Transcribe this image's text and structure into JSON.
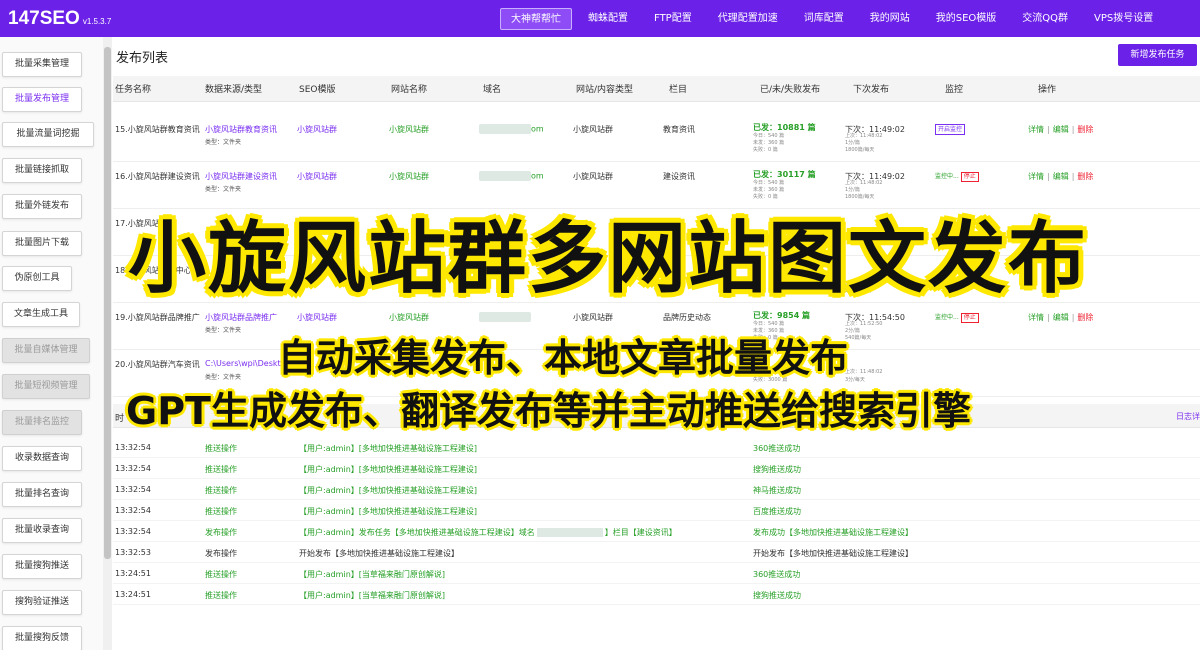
{
  "brand": {
    "name": "147SEO",
    "version": "v1.5.3.7"
  },
  "nav": [
    "大神帮帮忙",
    "蜘蛛配置",
    "FTP配置",
    "代理配置加速",
    "词库配置",
    "我的网站",
    "我的SEO模版",
    "交流QQ群",
    "VPS拨号设置"
  ],
  "sidebar": [
    "批量采集管理",
    "批量发布管理",
    "批量流量词挖掘",
    "批量链接抓取",
    "批量外链发布",
    "批量图片下载",
    "伪原创工具",
    "文章生成工具",
    "批量自媒体管理",
    "批量短视频管理",
    "批量排名监控",
    "收录数据查询",
    "批量排名查询",
    "批量收录查询",
    "批量搜狗推送",
    "搜狗验证推送",
    "批量搜狗反馈"
  ],
  "main": {
    "title": "发布列表",
    "new_task": "新增发布任务",
    "headers": [
      "任务名称",
      "数据来源/类型",
      "SEO模版",
      "网站名称",
      "域名",
      "网站/内容类型",
      "栏目",
      "已/未/失败发布",
      "下次发布",
      "监控",
      "操作"
    ]
  },
  "rows": [
    {
      "name": "15.小旋风站群教育资讯",
      "source": "小旋风站群教育资讯",
      "source_type": "类型：文件夹",
      "seo": "小旋风站群",
      "site": "小旋风站群",
      "domain_suffix": "om",
      "site_type": "小旋风站群",
      "column": "教育资讯",
      "published": "已发：10881 篇",
      "pub_small": [
        "今日：540 篇",
        "未发：360 篇",
        "失败：0 篇"
      ],
      "next": "下次：11:49:02",
      "next_small": [
        "上次：11:48:02",
        "1分/篇",
        "1800篇/每天"
      ],
      "monitor": "开启监控",
      "ops": [
        "详情",
        "编辑",
        "删除"
      ]
    },
    {
      "name": "16.小旋风站群建设资讯",
      "source": "小旋风站群建设资讯",
      "source_type": "类型：文件夹",
      "seo": "小旋风站群",
      "site": "小旋风站群",
      "domain_suffix": "om",
      "site_type": "小旋风站群",
      "column": "建设资讯",
      "published": "已发：30117 篇",
      "pub_small": [
        "今日：540 篇",
        "未发：360 篇",
        "失败：0 篇"
      ],
      "next": "下次：11:49:02",
      "next_small": [
        "上次：11:48:02",
        "1分/篇",
        "1800篇/每天"
      ],
      "monitor": "监控中...",
      "monitor_stop": "停止",
      "ops": [
        "详情",
        "编辑",
        "删除"
      ]
    },
    {
      "name": "17.小旋风站群",
      "source": "",
      "source_type": "类型：文件夹",
      "seo": "",
      "site": "",
      "domain_suffix": "",
      "site_type": "",
      "column": "",
      "published": "",
      "pub_small": [],
      "next": "",
      "next_small": [],
      "monitor": "",
      "ops": []
    },
    {
      "name": "18.小旋风站群品中心",
      "source": "",
      "source_type": "",
      "seo": "",
      "site": "",
      "domain_suffix": "",
      "site_type": "",
      "column": "",
      "published": "",
      "pub_small": [
        "未发：7500 篇",
        "失败：0 篇"
      ],
      "next": "",
      "next_small": [
        "2分/篇",
        "540篇/每天"
      ],
      "monitor": "",
      "ops": []
    },
    {
      "name": "19.小旋风站群品牌推广",
      "source": "小旋风站群品牌推广",
      "source_type": "类型：文件夹",
      "seo": "小旋风站群",
      "site": "小旋风站群",
      "domain_suffix": "",
      "site_type": "小旋风站群",
      "column": "品牌历史动态",
      "published": "已发：9854 篇",
      "pub_small": [
        "今日：540 篇",
        "未发：360 篇",
        "失败：0 篇"
      ],
      "next": "下次：11:54:50",
      "next_small": [
        "上次：11:52:50",
        "2分/篇",
        "540篇/每天"
      ],
      "monitor": "监控中...",
      "monitor_stop": "停止",
      "ops": [
        "详情",
        "编辑",
        "删除"
      ]
    },
    {
      "name": "20.小旋风站群汽车资讯",
      "source": "C:\\Users\\wpi\\Desktop\\",
      "source_type": "类型：文件夹",
      "seo": "",
      "site": "",
      "domain_suffix": "",
      "site_type": "",
      "column": "",
      "published": "",
      "pub_small": [
        "未发：321 篇",
        "失败：3000 篇"
      ],
      "next": "",
      "next_small": [
        "上次：11:48:02",
        "3分/每天"
      ],
      "monitor": "",
      "ops": []
    }
  ],
  "log": {
    "head": "时",
    "link": "日志详",
    "rows": [
      {
        "time": "13:32:54",
        "action": "推送操作",
        "msg": "【用户:admin】[多地加快推进基础设施工程建设]",
        "result": "360推送成功",
        "type": "push"
      },
      {
        "time": "13:32:54",
        "action": "推送操作",
        "msg": "【用户:admin】[多地加快推进基础设施工程建设]",
        "result": "搜狗推送成功",
        "type": "push"
      },
      {
        "time": "13:32:54",
        "action": "推送操作",
        "msg": "【用户:admin】[多地加快推进基础设施工程建设]",
        "result": "神马推送成功",
        "type": "push"
      },
      {
        "time": "13:32:54",
        "action": "推送操作",
        "msg": "【用户:admin】[多地加快推进基础设施工程建设]",
        "result": "百度推送成功",
        "type": "push"
      },
      {
        "time": "13:32:54",
        "action": "发布操作",
        "msg": "【用户:admin】发布任务【多地加快推进基础设施工程建设】域名",
        "msg_tail": "】栏目【建设资讯】",
        "result": "发布成功【多地加快推进基础设施工程建设】",
        "type": "publish"
      },
      {
        "time": "13:32:53",
        "action": "发布操作",
        "msg": "开始发布【多地加快推进基础设施工程建设】",
        "result": "开始发布【多地加快推进基础设施工程建设】",
        "type": "start"
      },
      {
        "time": "13:24:51",
        "action": "推送操作",
        "msg": "【用户:admin】[当草福来融门原创解说]",
        "result": "360推送成功",
        "type": "push"
      },
      {
        "time": "13:24:51",
        "action": "推送操作",
        "msg": "【用户:admin】[当草福来融门原创解说]",
        "result": "搜狗推送成功",
        "type": "push"
      }
    ]
  },
  "overlay": {
    "main": "小旋风站群多网站图文发布",
    "sub1": "自动采集发布、本地文章批量发布",
    "sub2": "GPT生成发布、翻译发布等并主动推送给搜索引擎"
  },
  "colors": {
    "accent": "#6b21e8",
    "green": "#28a028",
    "red": "#e22233",
    "highlight": "#ffe800"
  }
}
